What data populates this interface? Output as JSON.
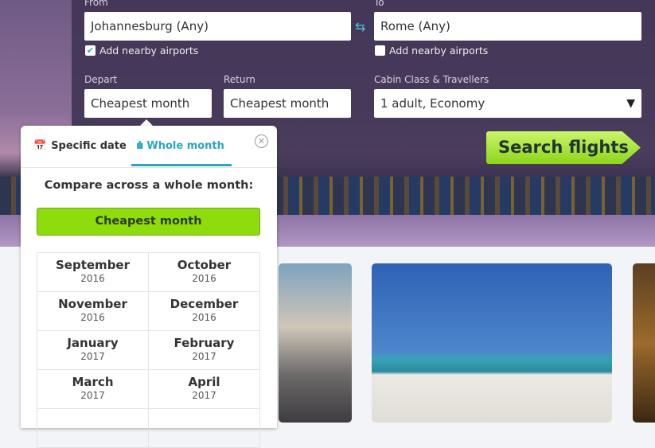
{
  "search_form": {
    "from_label": "From",
    "from_value": "Johannesburg (Any)",
    "to_label": "To",
    "to_value": "Rome (Any)",
    "from_nearby": {
      "label": "Add nearby airports",
      "checked": true
    },
    "to_nearby": {
      "label": "Add nearby airports",
      "checked": false
    },
    "depart_label": "Depart",
    "depart_value": "Cheapest month",
    "return_label": "Return",
    "return_value": "Cheapest month",
    "cabin_label": "Cabin Class & Travellers",
    "cabin_value": "1 adult, Economy",
    "search_button": "Search flights",
    "accent": "#8ed51a"
  },
  "date_popup": {
    "tabs": [
      {
        "label": "Specific date",
        "icon": "calendar-icon",
        "active": false
      },
      {
        "label": "Whole month",
        "icon": "bar-chart-icon",
        "active": true
      }
    ],
    "heading": "Compare across a whole month:",
    "cheapest_button": "Cheapest month",
    "months": [
      {
        "month": "September",
        "year": "2016"
      },
      {
        "month": "October",
        "year": "2016"
      },
      {
        "month": "November",
        "year": "2016"
      },
      {
        "month": "December",
        "year": "2016"
      },
      {
        "month": "January",
        "year": "2017"
      },
      {
        "month": "February",
        "year": "2017"
      },
      {
        "month": "March",
        "year": "2017"
      },
      {
        "month": "April",
        "year": "2017"
      }
    ],
    "tab_accent": "#2ba6c0"
  }
}
